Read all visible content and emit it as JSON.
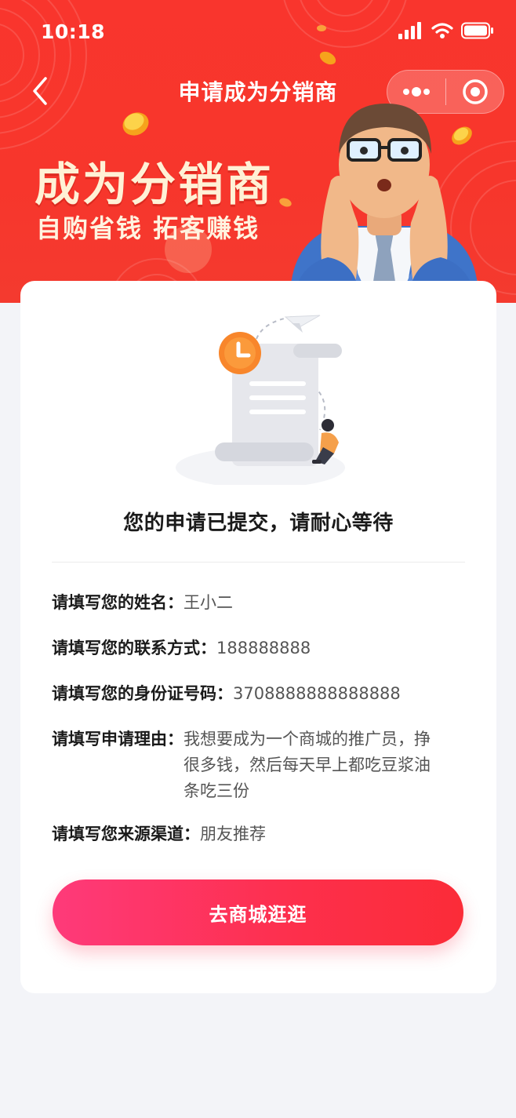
{
  "status_bar": {
    "time": "10:18"
  },
  "nav": {
    "title": "申请成为分销商"
  },
  "banner": {
    "headline": "成为分销商",
    "subline": "自购省钱 拓客赚钱"
  },
  "result": {
    "message": "您的申请已提交，请耐心等待"
  },
  "fields": [
    {
      "label": "请填写您的姓名：",
      "value": "王小二"
    },
    {
      "label": "请填写您的联系方式：",
      "value": "188888888"
    },
    {
      "label": "请填写您的身份证号码：",
      "value": "3708888888888888"
    },
    {
      "label": "请填写申请理由：",
      "value": "我想要成为一个商城的推广员，挣很多钱，然后每天早上都吃豆浆油条吃三份"
    },
    {
      "label": "请填写您来源渠道：",
      "value": "朋友推荐"
    }
  ],
  "cta": {
    "label": "去商城逛逛"
  },
  "colors": {
    "banner_red": "#f7362c",
    "cta_start": "#fe3a7a",
    "cta_end": "#fb2c38",
    "headline": "#fff1d6"
  }
}
